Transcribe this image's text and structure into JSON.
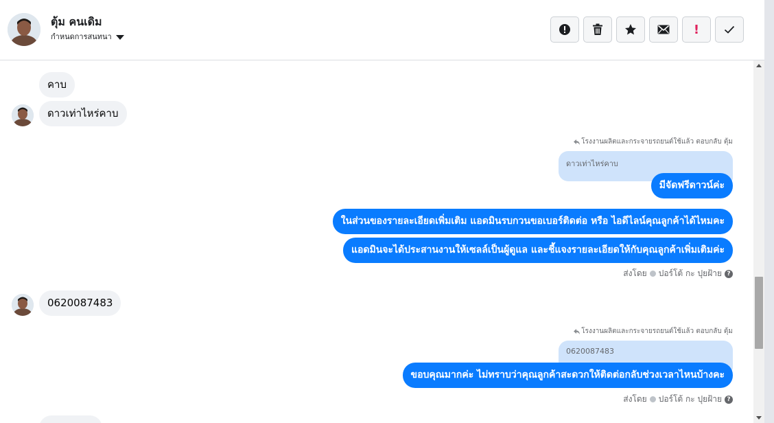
{
  "header": {
    "contact_name": "ตุ้ม คนเดิม",
    "assign_label": "กำหนดการสนทนา",
    "toolbar": [
      {
        "name": "spam-button",
        "icon": "alert-circle-icon"
      },
      {
        "name": "delete-button",
        "icon": "trash-icon"
      },
      {
        "name": "star-button",
        "icon": "star-icon"
      },
      {
        "name": "mark-unread-button",
        "icon": "envelope-icon"
      },
      {
        "name": "follow-up-button",
        "icon": "exclamation-icon",
        "text": "!"
      },
      {
        "name": "mark-done-button",
        "icon": "checkmark-icon"
      }
    ]
  },
  "messages": {
    "m1": "คาบ",
    "m2": "ดาวเท่าไหร่คาบ",
    "reply_meta_1": "โรงงานผลิตและกระจายรถยนต์ใช้แล้ว ตอบกลับ ตุ้ม",
    "quote_1": "ดาวเท่าไหร่คาบ",
    "m3": "มีจัดฟรีดาวน์ค่ะ",
    "m4": "ในส่วนของรายละเอียดเพิ่มเติม แอดมินรบกวนขอเบอร์ติดต่อ หรือ ไอดีไลน์คุณลูกค้าได้ไหมคะ",
    "m5": "แอดมินจะได้ประสานงานให้เซลล์เป็นผู้ดูแล และชี้แจงรายละเอียดให้กับคุณลูกค้าเพิ่มเติมค่ะ",
    "sent_by_1": "ส่งโดย",
    "sender_1": "ปอร์โต้ กะ ปุยฝ้าย",
    "m6": "0620087483",
    "reply_meta_2": "โรงงานผลิตและกระจายรถยนต์ใช้แล้ว ตอบกลับ ตุ้ม",
    "quote_2": "0620087483",
    "m7": "ขอบคุณมากค่ะ ไม่ทราบว่าคุณลูกค้าสะดวกให้ติดต่อกลับช่วงเวลาไหนบ้างคะ",
    "sent_by_2": "ส่งโดย",
    "sender_2": "ปอร์โต้ กะ ปุยฝ้าย",
    "help_glyph": "?"
  },
  "colors": {
    "outgoing_bubble": "#0a7cff",
    "incoming_bubble": "#f0f2f5",
    "quote_bubble": "#cfe3fb"
  }
}
